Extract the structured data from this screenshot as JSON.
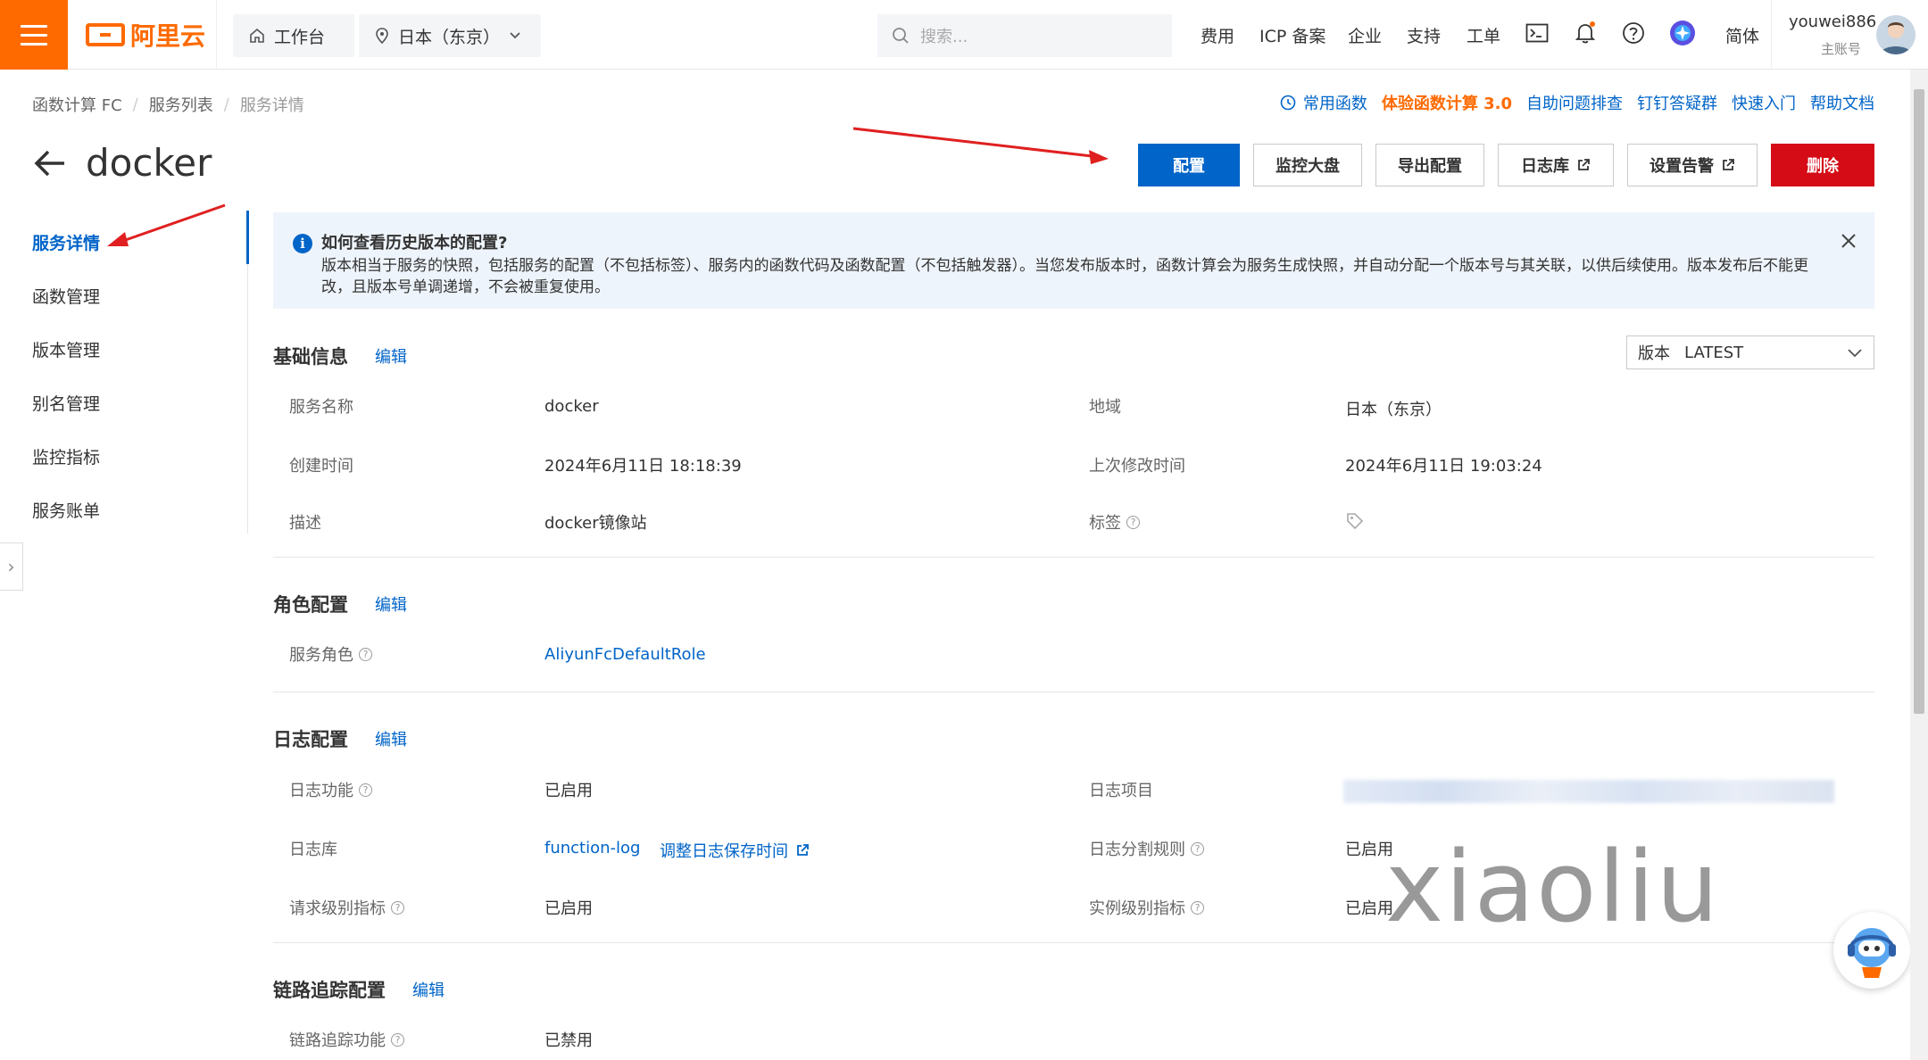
{
  "topbar": {
    "brand": "阿里云",
    "workbench": "工作台",
    "region": "日本（东京）",
    "search_placeholder": "搜索...",
    "links": [
      "费用",
      "ICP 备案",
      "企业",
      "支持",
      "工单"
    ],
    "lang": "简体",
    "user_name": "youwei886",
    "user_sub": "主账号"
  },
  "breadcrumb": [
    "函数计算 FC",
    "服务列表",
    "服务详情"
  ],
  "quick_links": {
    "common": "常用函数",
    "try": "体验函数计算 3.0",
    "self_check": "自助问题排查",
    "dingtalk": "钉钉答疑群",
    "quickstart": "快速入门",
    "help": "帮助文档"
  },
  "page": {
    "title": "docker"
  },
  "actions": {
    "config": "配置",
    "monitor": "监控大盘",
    "export": "导出配置",
    "logstore": "日志库",
    "alarm": "设置告警",
    "delete": "删除"
  },
  "sidenav": [
    "服务详情",
    "函数管理",
    "版本管理",
    "别名管理",
    "监控指标",
    "服务账单"
  ],
  "alert": {
    "title": "如何查看历史版本的配置?",
    "body": "版本相当于服务的快照，包括服务的配置（不包括标签）、服务内的函数代码及函数配置（不包括触发器）。当您发布版本时，函数计算会为服务生成快照，并自动分配一个版本号与其关联，以供后续使用。版本发布后不能更改，且版本号单调递增，不会被重复使用。"
  },
  "basic": {
    "title": "基础信息",
    "edit": "编辑",
    "version_label": "版本",
    "version_value": "LATEST",
    "service_name_label": "服务名称",
    "service_name": "docker",
    "region_label": "地域",
    "region": "日本（东京）",
    "created_label": "创建时间",
    "created": "2024年6月11日 18:18:39",
    "modified_label": "上次修改时间",
    "modified": "2024年6月11日 19:03:24",
    "desc_label": "描述",
    "desc": "docker镜像站",
    "tags_label": "标签"
  },
  "role": {
    "title": "角色配置",
    "edit": "编辑",
    "role_label": "服务角色",
    "role_value": "AliyunFcDefaultRole"
  },
  "log": {
    "title": "日志配置",
    "edit": "编辑",
    "feature_label": "日志功能",
    "feature_value": "已启用",
    "project_label": "日志项目",
    "store_label": "日志库",
    "store_value": "function-log",
    "retention_link": "调整日志保存时间",
    "split_label": "日志分割规则",
    "split_value": "已启用",
    "request_metric_label": "请求级别指标",
    "request_metric_value": "已启用",
    "instance_metric_label": "实例级别指标",
    "instance_metric_value": "已启用"
  },
  "trace": {
    "title": "链路追踪配置",
    "edit": "编辑",
    "feature_label": "链路追踪功能",
    "feature_value": "已禁用"
  },
  "watermark": "xiaoliu"
}
